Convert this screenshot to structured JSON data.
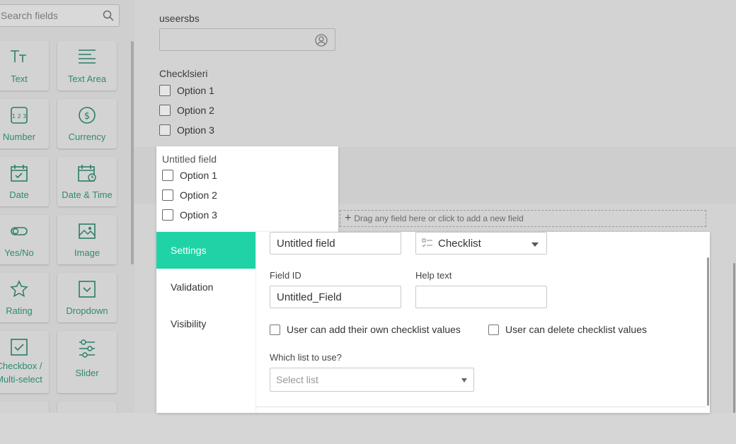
{
  "palette": {
    "search_placeholder": "Search fields",
    "tiles": [
      {
        "label": "Text",
        "icon": "text-type-icon"
      },
      {
        "label": "Text Area",
        "icon": "text-area-icon"
      },
      {
        "label": "Number",
        "icon": "number-icon"
      },
      {
        "label": "Currency",
        "icon": "currency-icon"
      },
      {
        "label": "Date",
        "icon": "calendar-icon"
      },
      {
        "label": "Date & Time",
        "icon": "calendar-clock-icon"
      },
      {
        "label": "Yes/No",
        "icon": "toggle-icon"
      },
      {
        "label": "Image",
        "icon": "image-icon"
      },
      {
        "label": "Rating",
        "icon": "star-icon"
      },
      {
        "label": "Dropdown",
        "icon": "dropdown-icon"
      },
      {
        "label": "Checkbox /\nMulti-select",
        "icon": "checkbox-icon"
      },
      {
        "label": "Slider",
        "icon": "slider-icon"
      }
    ]
  },
  "canvas": {
    "user_field_label": "useersbs",
    "checklist_label": "Checklsieri",
    "checklist_options": [
      "Option 1",
      "Option 2",
      "Option 3"
    ],
    "drag_hint": "Drag any field here or click to add a new field"
  },
  "active_field": {
    "label": "Untitled field",
    "options": [
      "Option 1",
      "Option 2",
      "Option 3"
    ]
  },
  "editor": {
    "tabs": [
      "Settings",
      "Validation",
      "Visibility"
    ],
    "active_tab": "Settings",
    "field_name_value": "Untitled field",
    "field_type": "Checklist",
    "field_id_label": "Field ID",
    "field_id_value": "Untitled_Field",
    "help_text_label": "Help text",
    "help_text_value": "",
    "allow_add_label": "User can add their own checklist values",
    "allow_delete_label": "User can delete checklist values",
    "list_label": "Which list to use?",
    "list_placeholder": "Select list"
  },
  "colors": {
    "accent": "#1fd3a6",
    "icon_green": "#2c7c66"
  }
}
